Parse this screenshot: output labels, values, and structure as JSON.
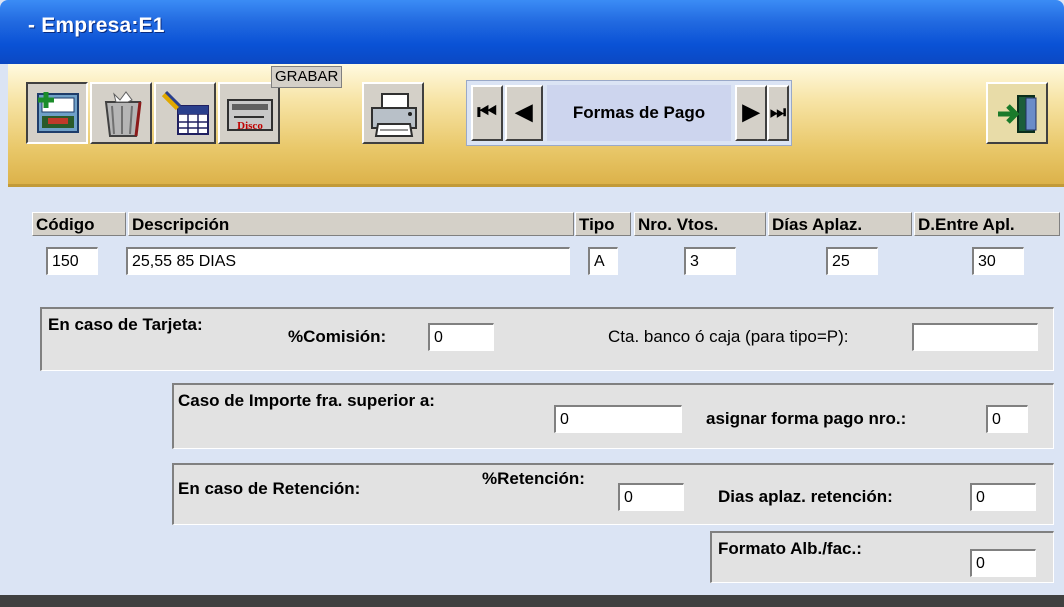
{
  "window": {
    "title": "- Empresa:E1"
  },
  "toolbar": {
    "buttons": [
      {
        "name": "new-record",
        "icon": "new-record-icon"
      },
      {
        "name": "delete",
        "icon": "trash-icon"
      },
      {
        "name": "search",
        "icon": "search-table-icon"
      },
      {
        "name": "save",
        "icon": "save-disk-icon",
        "tooltip": "GRABAR",
        "text": "Disco"
      },
      {
        "name": "print",
        "icon": "printer-icon"
      }
    ],
    "save_tooltip": "GRABAR",
    "save_icon_text": "Disco",
    "nav": {
      "first_icon": "first-record-icon",
      "prev_icon": "prev-record-icon",
      "next_icon": "next-record-icon",
      "last_icon": "last-record-icon",
      "label": "Formas de Pago"
    },
    "exit_icon": "exit-door-icon"
  },
  "form": {
    "headers": {
      "codigo": "Código",
      "descripcion": "Descripción",
      "tipo": "Tipo",
      "nro_vtos": "Nro. Vtos.",
      "dias_aplaz": "Días Aplaz.",
      "d_entre_apl": "D.Entre Apl."
    },
    "values": {
      "codigo": "150",
      "descripcion": "25,55 85 DIAS",
      "tipo": "A",
      "nro_vtos": "3",
      "dias_aplaz": "25",
      "d_entre_apl": "30"
    },
    "tarjeta": {
      "label": "En caso de Tarjeta:",
      "comision_label": "%Comisión:",
      "comision_value": "0",
      "cta_label": "Cta. banco ó caja (para tipo=P):",
      "cta_value": ""
    },
    "importe": {
      "label": "Caso de Importe fra. superior a:",
      "value": "0",
      "asignar_label": "asignar forma pago nro.:",
      "asignar_value": "0"
    },
    "retencion": {
      "label": "En caso de Retención:",
      "pct_label": "%Retención:",
      "pct_value": "0",
      "dias_label": "Dias aplaz. retención:",
      "dias_value": "0"
    },
    "formato": {
      "label": "Formato Alb./fac.:",
      "value": "0"
    }
  },
  "colors": {
    "titlebar": "#0a52d6",
    "toolbar": "#e9c86a",
    "window_bg": "#dbe4f4",
    "button_face": "#d4d0c8"
  }
}
